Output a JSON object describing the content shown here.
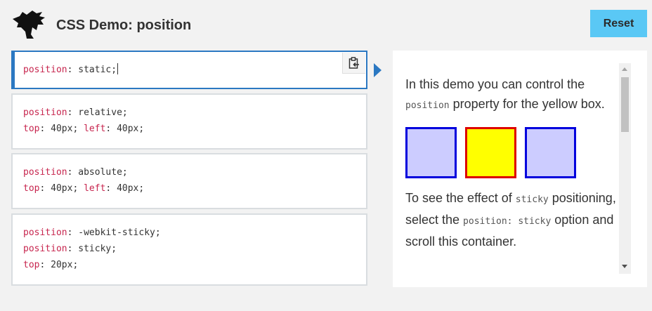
{
  "header": {
    "title": "CSS Demo: position",
    "reset_label": "Reset",
    "logo_icon": "dinosaur-logo-icon"
  },
  "options": [
    {
      "lines": [
        {
          "prop": "position",
          "value": "static;"
        }
      ],
      "selected": true
    },
    {
      "lines": [
        {
          "prop": "position",
          "value": "relative;"
        },
        {
          "prop": "top",
          "value": "40px;",
          "prop2": "left",
          "value2": "40px;"
        }
      ],
      "selected": false
    },
    {
      "lines": [
        {
          "prop": "position",
          "value": "absolute;"
        },
        {
          "prop": "top",
          "value": "40px;",
          "prop2": "left",
          "value2": "40px;"
        }
      ],
      "selected": false
    },
    {
      "lines": [
        {
          "prop": "position",
          "value": "-webkit-sticky;"
        },
        {
          "prop": "position",
          "value": "sticky;"
        },
        {
          "prop": "top",
          "value": "20px;"
        }
      ],
      "selected": false
    }
  ],
  "copy_icon": "clipboard-copy-icon",
  "output": {
    "para1_before": "In this demo you can control the ",
    "para1_code": "position",
    "para1_after": " property for the yellow box.",
    "para2_before": "To see the effect of ",
    "para2_code1": "sticky",
    "para2_mid": " positioning, select the ",
    "para2_code2": "position: sticky",
    "para2_after": " option and scroll this container."
  },
  "colors": {
    "accent": "#2b78c2",
    "reset_button": "#5ac8f5",
    "property_name": "#c7254e",
    "box_fill": "#ccccff",
    "box_border": "#0000dd",
    "highlight_fill": "#ffff00",
    "highlight_border": "#dd0000"
  }
}
